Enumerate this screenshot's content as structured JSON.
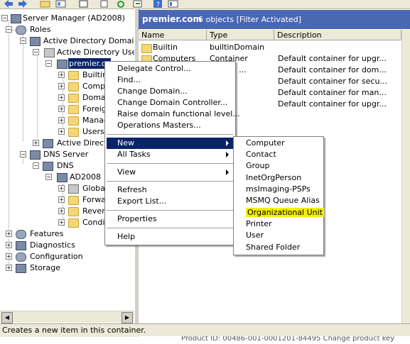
{
  "tree": {
    "root": "Server Manager (AD2008)",
    "roles": "Roles",
    "adds": "Active Directory Domain Se",
    "aduc": "Active Directory Users .",
    "domain": "premier.co",
    "builtin": "Builtin",
    "computers": "Compu",
    "domainc": "Domai",
    "foreign": "Foreig",
    "managed": "Manag",
    "users": "Users",
    "adsites": "Active Directo",
    "dnsserver": "DNS Server",
    "dns": "DNS",
    "ad2008": "AD2008",
    "global": "Global",
    "forward": "Forwa",
    "reverse": "Revers",
    "conditional": "Condit",
    "features": "Features",
    "diagnostics": "Diagnostics",
    "configuration": "Configuration",
    "storage": "Storage"
  },
  "rightpane": {
    "title": "premier.com",
    "count": "6 objects  [Filter Activated]",
    "columns": {
      "name": "Name",
      "type": "Type",
      "description": "Description"
    },
    "rows": [
      {
        "name": "Builtin",
        "type": "builtinDomain",
        "description": ""
      },
      {
        "name": "Computers",
        "type": "Container",
        "description": "Default container for upgr..."
      },
      {
        "name": "",
        "type": "ational ...",
        "description": "Default container for dom..."
      },
      {
        "name": "",
        "type": "er",
        "description": "Default container for secu..."
      },
      {
        "name": "",
        "type": "er",
        "description": "Default container for man..."
      },
      {
        "name": "",
        "type": "er",
        "description": "Default container for upgr..."
      }
    ]
  },
  "context_menu": {
    "delegate": "Delegate Control...",
    "find": "Find...",
    "change_domain": "Change Domain...",
    "change_dc": "Change Domain Controller...",
    "raise": "Raise domain functional level...",
    "ops_masters": "Operations Masters...",
    "new": "New",
    "all_tasks": "All Tasks",
    "view": "View",
    "refresh": "Refresh",
    "export": "Export List...",
    "properties": "Properties",
    "help": "Help"
  },
  "submenu": {
    "computer": "Computer",
    "contact": "Contact",
    "group": "Group",
    "inetorgperson": "InetOrgPerson",
    "msimaging": "msImaging-PSPs",
    "msmq": "MSMQ Queue Alias",
    "ou": "Organizational Unit",
    "printer": "Printer",
    "user": "User",
    "shared_folder": "Shared Folder"
  },
  "status": "Creates a new item in this container.",
  "underlay": "Product ID: 00486-001-0001201-84495     Change product key",
  "colors": {
    "selection": "#0a246a",
    "header": "#4a67b4",
    "highlight": "#f4f000"
  }
}
